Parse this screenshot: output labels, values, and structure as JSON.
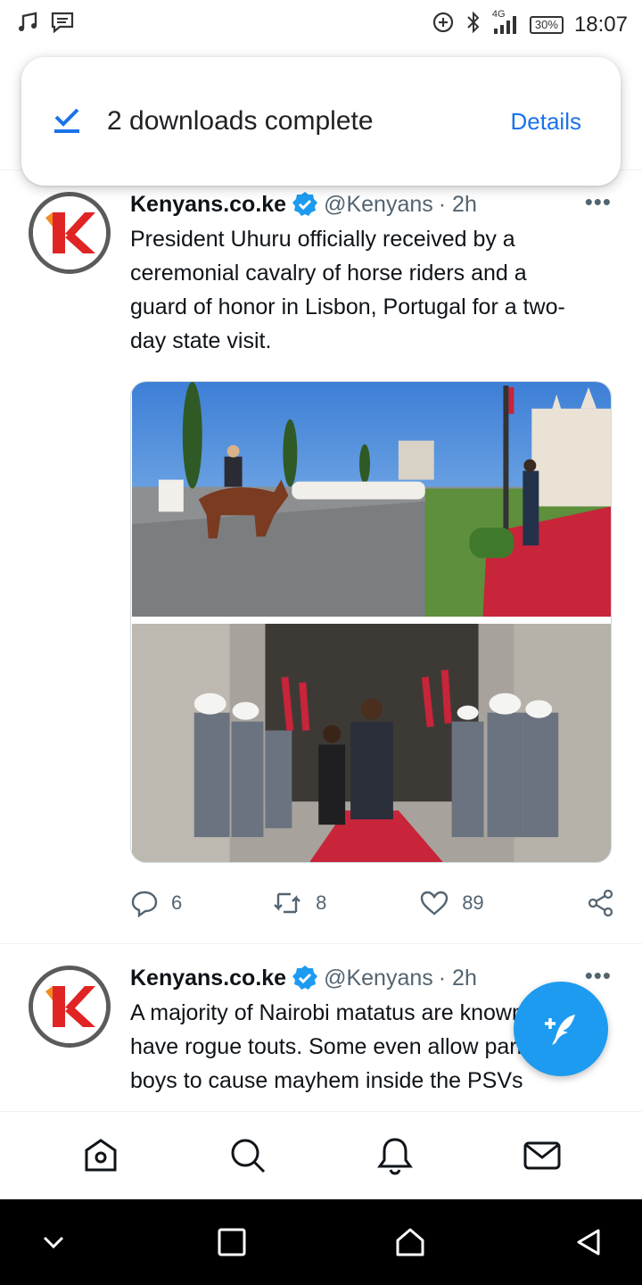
{
  "status_bar": {
    "time": "18:07",
    "battery": "30%",
    "network": "4G",
    "icons": [
      "music-note-icon",
      "message-icon",
      "data-saver-icon",
      "bluetooth-icon",
      "signal-icon",
      "battery-icon"
    ]
  },
  "download_toast": {
    "icon": "check-icon",
    "message": "2 downloads complete",
    "action": "Details"
  },
  "tweets": [
    {
      "author_name": "Kenyans.co.ke",
      "handle": "@Kenyans",
      "time_ago": "· 2h",
      "text": "President Uhuru officially received by a ceremonial cavalry of horse riders and a guard of honor in Lisbon, Portugal for a two-day state visit.",
      "replies": "6",
      "retweets": "8",
      "likes": "89"
    },
    {
      "author_name": "Kenyans.co.ke",
      "handle": "@Kenyans",
      "time_ago": "· 2h",
      "text": "A majority of Nairobi matatus are known to have rogue touts. Some even allow parking boys to cause mayhem inside the PSVs"
    }
  ],
  "bottom_nav": {
    "items": [
      "home-icon",
      "search-icon",
      "notifications-icon",
      "messages-icon"
    ]
  },
  "system_nav": {
    "items": [
      "collapse-icon",
      "recents-icon",
      "home-icon",
      "back-icon"
    ]
  },
  "colors": {
    "accent": "#1d9bf0",
    "toast_action": "#1a73e8",
    "text": "#0f1419",
    "muted": "#536471",
    "logo_red": "#e02424",
    "logo_orange": "#f28b20"
  }
}
